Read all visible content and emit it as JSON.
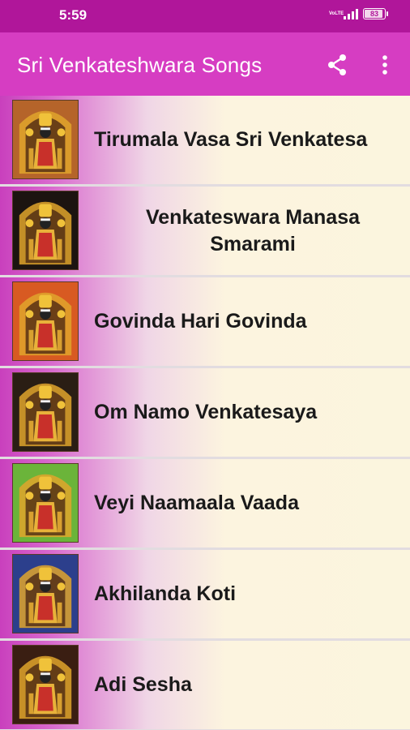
{
  "status_bar": {
    "time": "5:59",
    "network": "VoLTE",
    "battery": "83"
  },
  "app_bar": {
    "title": "Sri Venkateshwara Songs",
    "share_icon": "share-icon",
    "menu_icon": "more-vert-icon"
  },
  "colors": {
    "status_bar": "#b0169a",
    "app_bar": "#d63dc2",
    "row_start": "#c940bd",
    "row_end": "#fbf5de"
  },
  "songs": [
    {
      "title": "Tirumala Vasa Sri Venkatesa",
      "thumbnail": "deity-image",
      "bg": "#b5642a"
    },
    {
      "title": "Venkateswara Manasa Smarami",
      "thumbnail": "deity-image",
      "bg": "#1c1410"
    },
    {
      "title": "Govinda Hari Govinda",
      "thumbnail": "deity-image",
      "bg": "#d85a22"
    },
    {
      "title": "Om Namo Venkatesaya",
      "thumbnail": "deity-image",
      "bg": "#2a1e14"
    },
    {
      "title": "Veyi Naamaala Vaada",
      "thumbnail": "deity-image",
      "bg": "#6bb43a"
    },
    {
      "title": "Akhilanda Koti",
      "thumbnail": "deity-image",
      "bg": "#2c3f8c"
    },
    {
      "title": "Adi Sesha",
      "thumbnail": "deity-image",
      "bg": "#3a1e12"
    }
  ]
}
